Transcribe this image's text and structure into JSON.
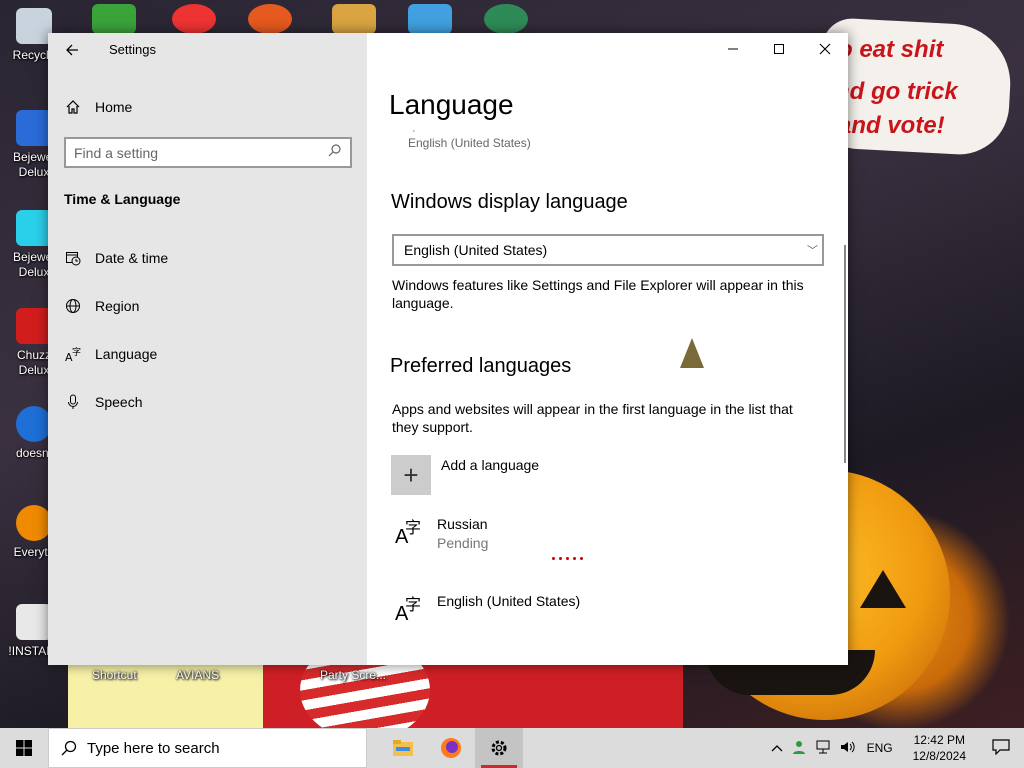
{
  "desktop": {
    "icons_left": [
      {
        "label": "Recycle",
        "color": "#c9d3de"
      },
      {
        "label": "Bejewel Delux",
        "color": "#2b6bd8"
      },
      {
        "label": "Bejewel Delux",
        "color": "#2ad0ea"
      },
      {
        "label": "Chuzz Delux",
        "color": "#d21d1d"
      },
      {
        "label": "doesnt",
        "color": "#1e6fd6"
      },
      {
        "label": "Everyth",
        "color": "#f08a00"
      },
      {
        "label": "!INSTALL",
        "color": "#e8e8e8"
      }
    ],
    "captions_bottom": [
      "Shortcut",
      "AVIANS",
      "Party Scre..."
    ],
    "wallpaper_text": [
      "o eat shit",
      "nd go trick",
      "and vote!"
    ]
  },
  "window": {
    "title": "Settings",
    "sidebar": {
      "home_label": "Home",
      "search_placeholder": "Find a setting",
      "section_title": "Time & Language",
      "items": [
        {
          "label": "Date & time",
          "icon": "calendar-clock-icon"
        },
        {
          "label": "Region",
          "icon": "globe-icon"
        },
        {
          "label": "Language",
          "icon": "language-icon"
        },
        {
          "label": "Speech",
          "icon": "microphone-icon"
        }
      ]
    },
    "content": {
      "page_title": "Language",
      "subtitle_dot": "·",
      "subtitle_lang": "English (United States)",
      "display_language": {
        "heading": "Windows display language",
        "selected": "English (United States)",
        "description": "Windows features like Settings and File Explorer will appear in this language."
      },
      "preferred_languages": {
        "heading": "Preferred languages",
        "description": "Apps and websites will appear in the first language in the list that they support.",
        "add_label": "Add a language",
        "languages": [
          {
            "name": "Russian",
            "status": "Pending"
          },
          {
            "name": "English (United States)",
            "status": ""
          }
        ]
      }
    }
  },
  "taskbar": {
    "search_placeholder": "Type here to search",
    "input_lang": "ENG",
    "time": "12:42 PM",
    "date": "12/8/2024"
  },
  "colors": {
    "sidebar_bg": "#e6e6e6",
    "taskbar_bg": "#dcdcdc",
    "active_indicator": "#c52c2c"
  }
}
